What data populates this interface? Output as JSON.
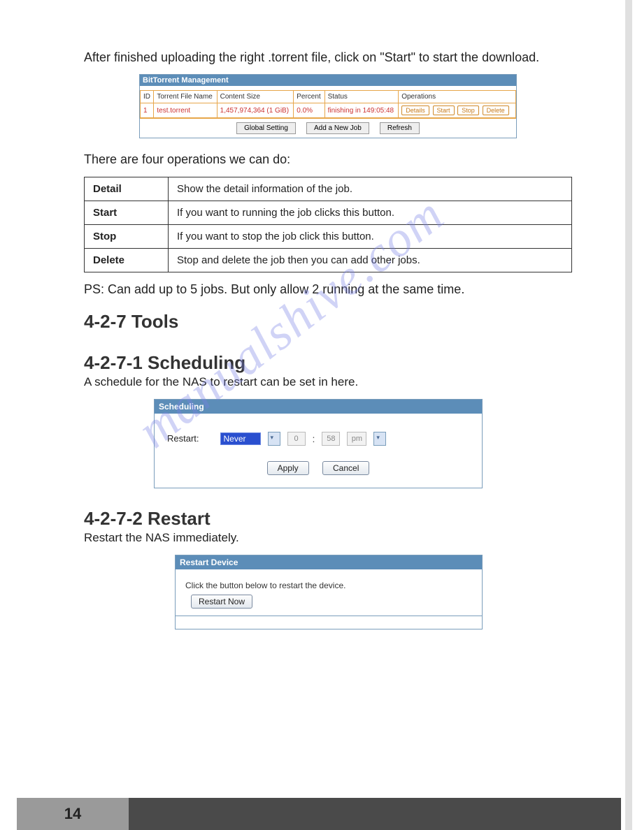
{
  "intro_text": "After finished uploading the right .torrent file, click on \"Start\" to start the download.",
  "bt": {
    "panel_title": "BitTorrent Management",
    "headers": [
      "ID",
      "Torrent File Name",
      "Content Size",
      "Percent",
      "Status",
      "Operations"
    ],
    "row": {
      "id": "1",
      "file": "test.torrent",
      "size": "1,457,974,364 (1 GiB)",
      "percent": "0.0%",
      "status": "finishing in 149:05:48",
      "ops": [
        "Details",
        "Start",
        "Stop",
        "Delete"
      ]
    },
    "footer_buttons": [
      "Global Setting",
      "Add a New Job",
      "Refresh"
    ]
  },
  "ops_intro": "There are four operations we can do:",
  "ops_rows": [
    {
      "key": "Detail",
      "desc": "Show the detail information of the job."
    },
    {
      "key": "Start",
      "desc": "If you want to running the job clicks this button."
    },
    {
      "key": "Stop",
      "desc": "If you want to stop the job click this button."
    },
    {
      "key": "Delete",
      "desc": "Stop and delete the job then you can add other jobs."
    }
  ],
  "ps_text": "PS:  Can add up to 5 jobs. But only allow 2 running at the same time.",
  "sec_tools": "4-2-7 Tools",
  "sec_sched": "4-2-7-1 Scheduling",
  "sched_desc": "A schedule for the NAS to restart can be set in here.",
  "sched": {
    "panel_title": "Scheduling",
    "label": "Restart:",
    "freq_value": "Never",
    "hour": "0",
    "minute": "58",
    "ampm": "pm",
    "apply": "Apply",
    "cancel": "Cancel"
  },
  "sec_restart": "4-2-7-2 Restart",
  "restart_desc": "Restart the NAS immediately.",
  "restart": {
    "panel_title": "Restart Device",
    "body_text": "Click the button below to restart the device.",
    "button": "Restart Now"
  },
  "watermark": "manualshive.com",
  "page_number": "14"
}
